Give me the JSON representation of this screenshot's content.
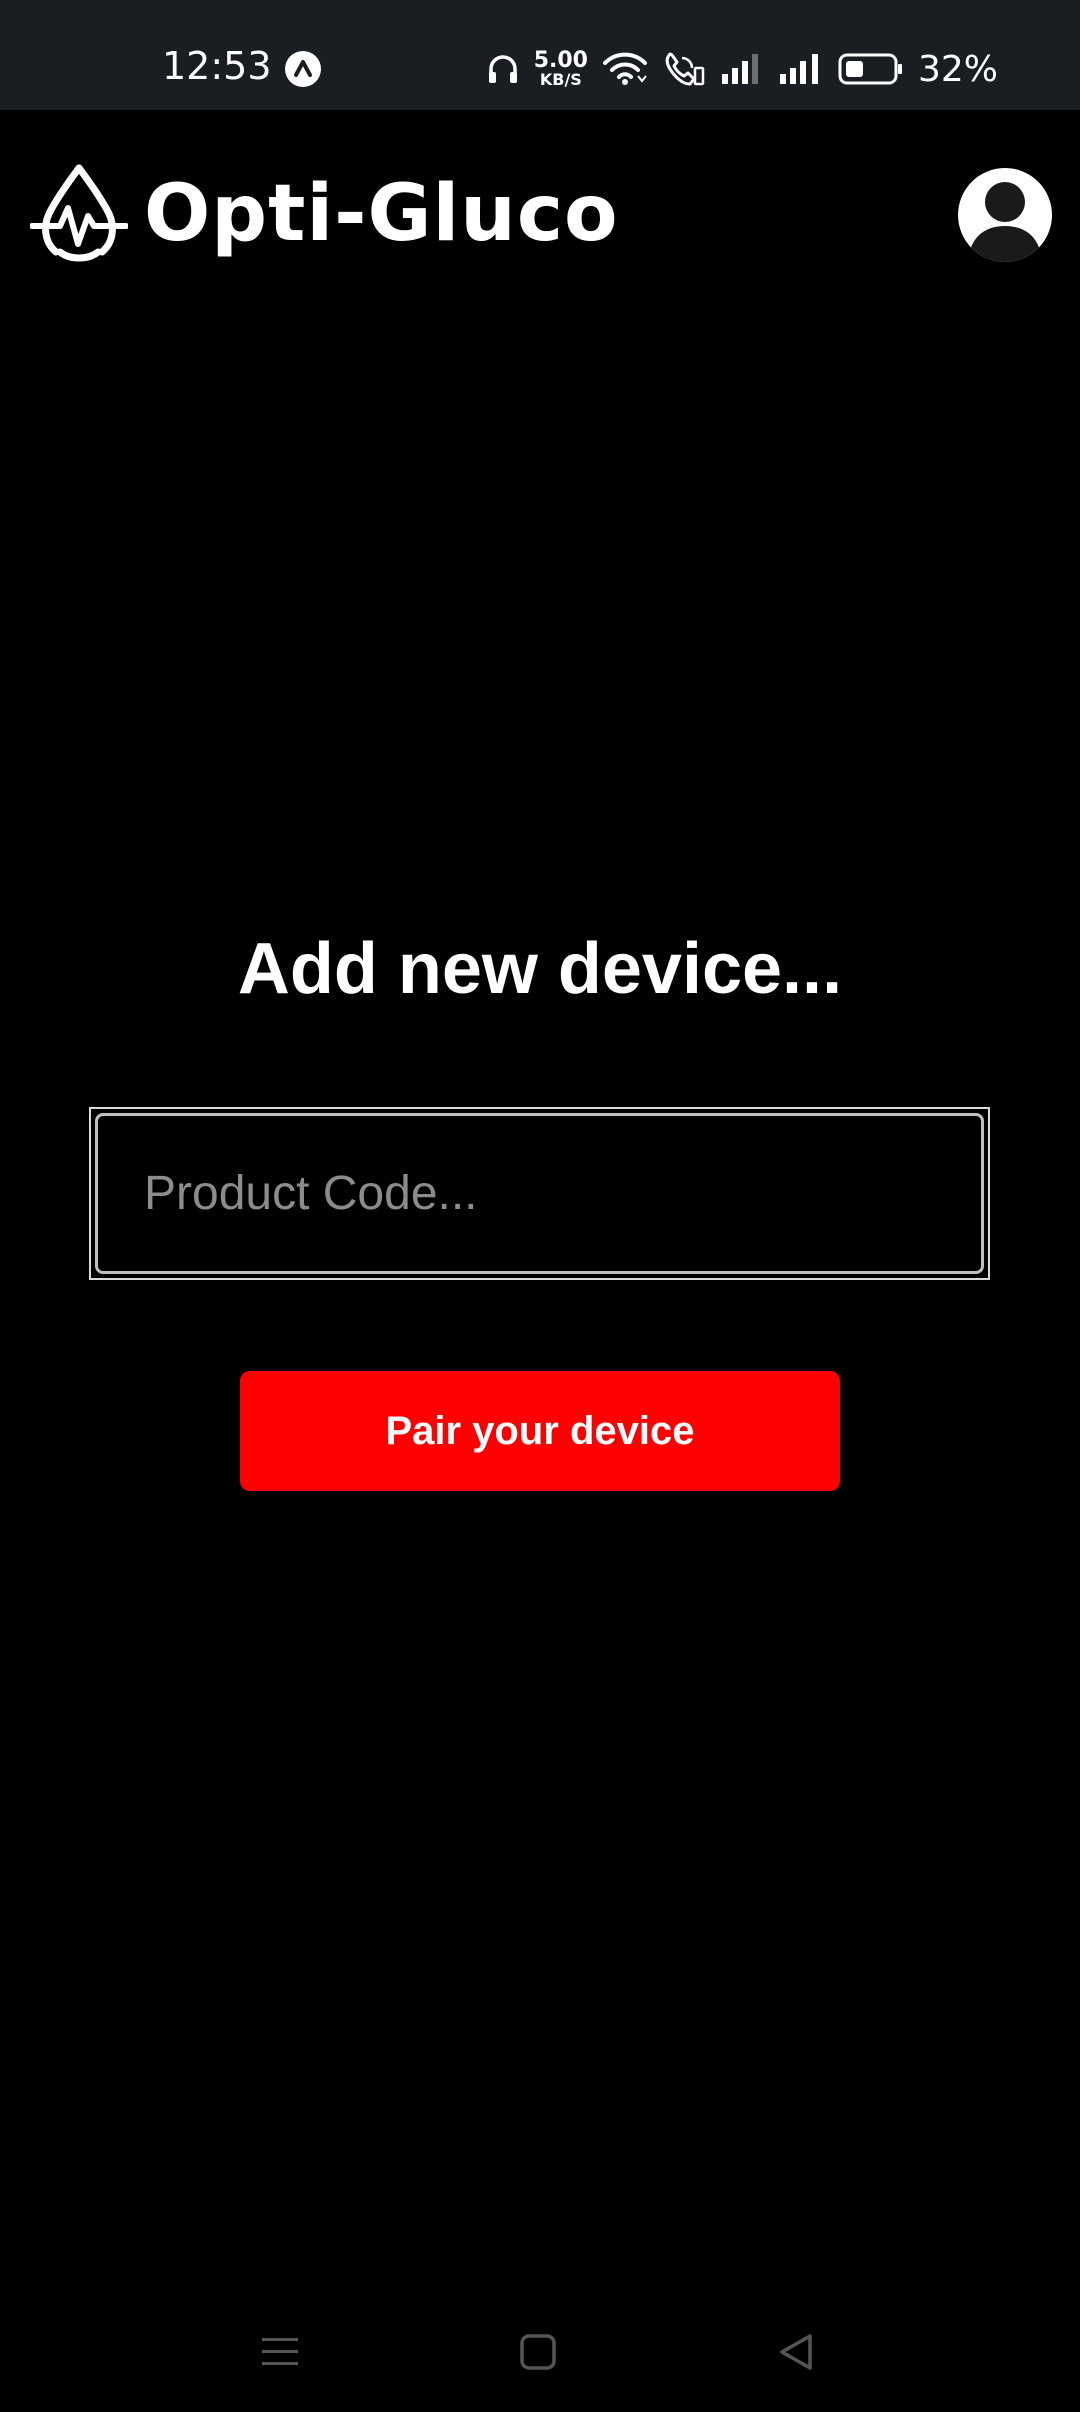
{
  "status_bar": {
    "time": "12:53",
    "net_speed_value": "5.00",
    "net_speed_unit": "KB/S",
    "battery_percent": "32%"
  },
  "header": {
    "app_name": "Opti-Gluco",
    "logo_icon": "heartbeat-drop-icon",
    "avatar_icon": "user-avatar-icon"
  },
  "main": {
    "title": "Add new device...",
    "product_code_placeholder": "Product Code...",
    "product_code_value": "",
    "pair_button_label": "Pair your device"
  },
  "nav_bar": {
    "icons": [
      "menu-icon",
      "home-icon",
      "back-icon"
    ]
  },
  "colors": {
    "background": "#000000",
    "status_bar": "#1a1d22",
    "accent": "#ff0000",
    "text": "#ffffff",
    "placeholder": "#8c8c8c"
  }
}
